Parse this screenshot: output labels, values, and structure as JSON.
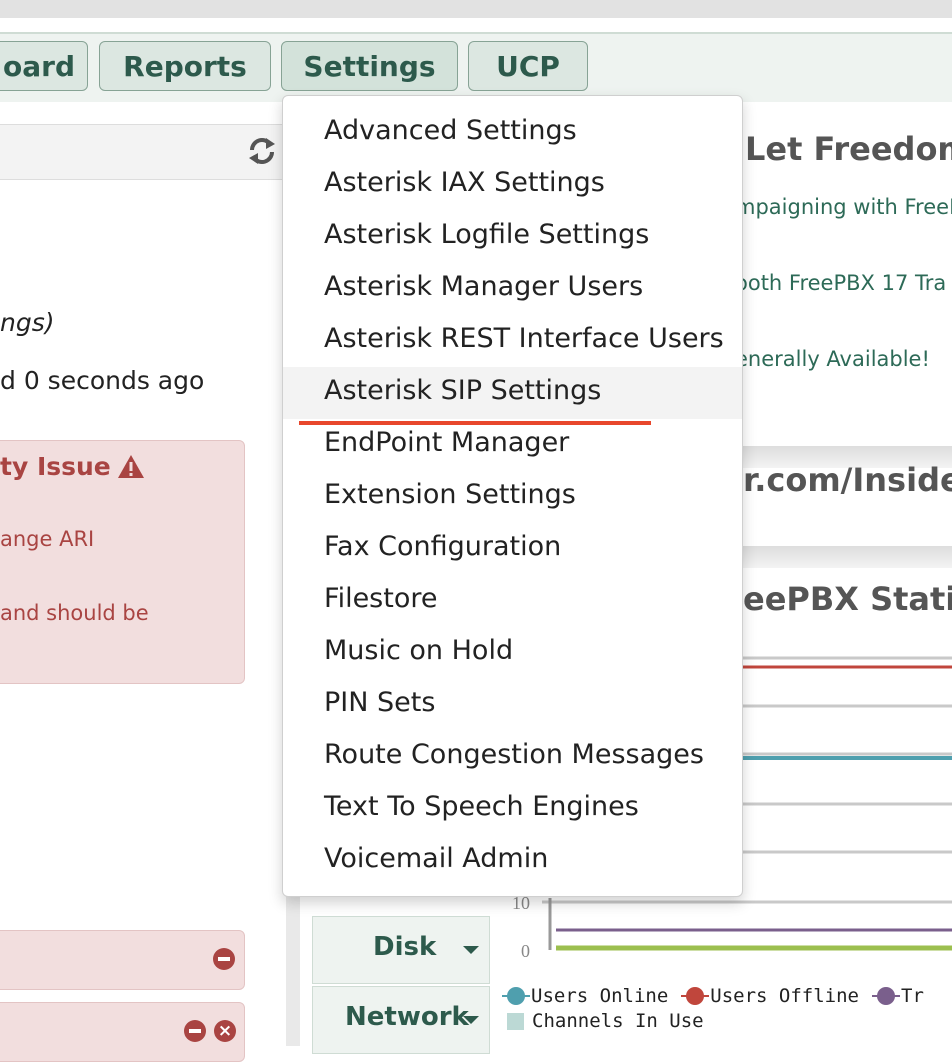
{
  "nav": {
    "buttons": [
      {
        "label": "oard"
      },
      {
        "label": "Reports"
      },
      {
        "label": "Settings"
      },
      {
        "label": "UCP"
      }
    ]
  },
  "left_panel": {
    "italic_text": "ngs)",
    "updated_text": "d 0 seconds ago",
    "alert": {
      "title": "ty Issue",
      "line1": "ange ARI",
      "line2": " and should be"
    }
  },
  "right_panel": {
    "news_title": "Let Freedom",
    "news_links": [
      "mpaigning with FreeI",
      "ooth FreePBX 17 Tra",
      "enerally Available!"
    ],
    "section2_title": "r.com/Inside",
    "stats_title": "eePBX Statist",
    "side_tabs": [
      {
        "label": "Disk"
      },
      {
        "label": "Network"
      }
    ]
  },
  "settings_menu": {
    "items": [
      "Advanced Settings",
      "Asterisk IAX Settings",
      "Asterisk Logfile Settings",
      "Asterisk Manager Users",
      "Asterisk REST Interface Users",
      "Asterisk SIP Settings",
      "EndPoint Manager",
      "Extension Settings",
      "Fax Configuration",
      "Filestore",
      "Music on Hold",
      "PIN Sets",
      "Route Congestion Messages",
      "Text To Speech Engines",
      "Voicemail Admin"
    ],
    "hovered_item": "Asterisk SIP Settings"
  },
  "chart_data": {
    "type": "line",
    "y_ticks": [
      0,
      10
    ],
    "series": [
      {
        "name": "Users Online",
        "color": "#4f9fae"
      },
      {
        "name": "Users Offline",
        "color": "#c0463c"
      },
      {
        "name": "Tr",
        "color": "#7a5f8c"
      },
      {
        "name": "Channels In Use",
        "color": "#bcd9d5"
      }
    ]
  },
  "colors": {
    "accent": "#2d5a4c",
    "alert_text": "#a94442",
    "menu_underline": "#e8472c"
  }
}
